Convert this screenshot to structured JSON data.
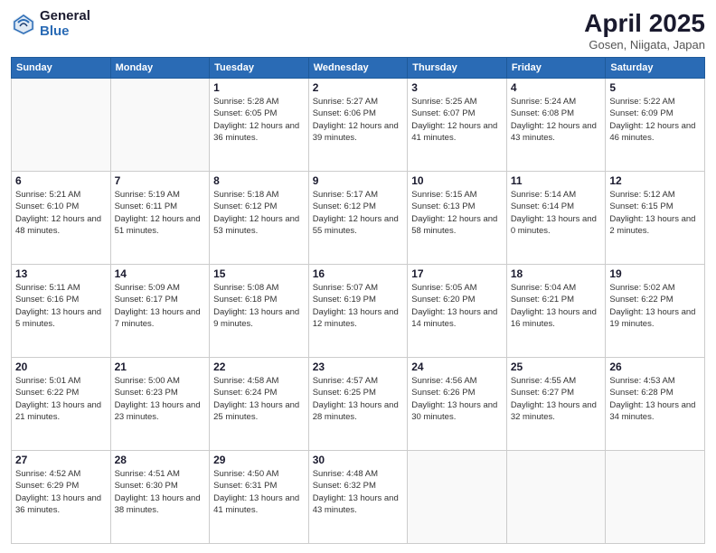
{
  "logo": {
    "general": "General",
    "blue": "Blue"
  },
  "title": "April 2025",
  "subtitle": "Gosen, Niigata, Japan",
  "days": [
    "Sunday",
    "Monday",
    "Tuesday",
    "Wednesday",
    "Thursday",
    "Friday",
    "Saturday"
  ],
  "weeks": [
    [
      {
        "day": "",
        "info": ""
      },
      {
        "day": "",
        "info": ""
      },
      {
        "day": "1",
        "info": "Sunrise: 5:28 AM\nSunset: 6:05 PM\nDaylight: 12 hours and 36 minutes."
      },
      {
        "day": "2",
        "info": "Sunrise: 5:27 AM\nSunset: 6:06 PM\nDaylight: 12 hours and 39 minutes."
      },
      {
        "day": "3",
        "info": "Sunrise: 5:25 AM\nSunset: 6:07 PM\nDaylight: 12 hours and 41 minutes."
      },
      {
        "day": "4",
        "info": "Sunrise: 5:24 AM\nSunset: 6:08 PM\nDaylight: 12 hours and 43 minutes."
      },
      {
        "day": "5",
        "info": "Sunrise: 5:22 AM\nSunset: 6:09 PM\nDaylight: 12 hours and 46 minutes."
      }
    ],
    [
      {
        "day": "6",
        "info": "Sunrise: 5:21 AM\nSunset: 6:10 PM\nDaylight: 12 hours and 48 minutes."
      },
      {
        "day": "7",
        "info": "Sunrise: 5:19 AM\nSunset: 6:11 PM\nDaylight: 12 hours and 51 minutes."
      },
      {
        "day": "8",
        "info": "Sunrise: 5:18 AM\nSunset: 6:12 PM\nDaylight: 12 hours and 53 minutes."
      },
      {
        "day": "9",
        "info": "Sunrise: 5:17 AM\nSunset: 6:12 PM\nDaylight: 12 hours and 55 minutes."
      },
      {
        "day": "10",
        "info": "Sunrise: 5:15 AM\nSunset: 6:13 PM\nDaylight: 12 hours and 58 minutes."
      },
      {
        "day": "11",
        "info": "Sunrise: 5:14 AM\nSunset: 6:14 PM\nDaylight: 13 hours and 0 minutes."
      },
      {
        "day": "12",
        "info": "Sunrise: 5:12 AM\nSunset: 6:15 PM\nDaylight: 13 hours and 2 minutes."
      }
    ],
    [
      {
        "day": "13",
        "info": "Sunrise: 5:11 AM\nSunset: 6:16 PM\nDaylight: 13 hours and 5 minutes."
      },
      {
        "day": "14",
        "info": "Sunrise: 5:09 AM\nSunset: 6:17 PM\nDaylight: 13 hours and 7 minutes."
      },
      {
        "day": "15",
        "info": "Sunrise: 5:08 AM\nSunset: 6:18 PM\nDaylight: 13 hours and 9 minutes."
      },
      {
        "day": "16",
        "info": "Sunrise: 5:07 AM\nSunset: 6:19 PM\nDaylight: 13 hours and 12 minutes."
      },
      {
        "day": "17",
        "info": "Sunrise: 5:05 AM\nSunset: 6:20 PM\nDaylight: 13 hours and 14 minutes."
      },
      {
        "day": "18",
        "info": "Sunrise: 5:04 AM\nSunset: 6:21 PM\nDaylight: 13 hours and 16 minutes."
      },
      {
        "day": "19",
        "info": "Sunrise: 5:02 AM\nSunset: 6:22 PM\nDaylight: 13 hours and 19 minutes."
      }
    ],
    [
      {
        "day": "20",
        "info": "Sunrise: 5:01 AM\nSunset: 6:22 PM\nDaylight: 13 hours and 21 minutes."
      },
      {
        "day": "21",
        "info": "Sunrise: 5:00 AM\nSunset: 6:23 PM\nDaylight: 13 hours and 23 minutes."
      },
      {
        "day": "22",
        "info": "Sunrise: 4:58 AM\nSunset: 6:24 PM\nDaylight: 13 hours and 25 minutes."
      },
      {
        "day": "23",
        "info": "Sunrise: 4:57 AM\nSunset: 6:25 PM\nDaylight: 13 hours and 28 minutes."
      },
      {
        "day": "24",
        "info": "Sunrise: 4:56 AM\nSunset: 6:26 PM\nDaylight: 13 hours and 30 minutes."
      },
      {
        "day": "25",
        "info": "Sunrise: 4:55 AM\nSunset: 6:27 PM\nDaylight: 13 hours and 32 minutes."
      },
      {
        "day": "26",
        "info": "Sunrise: 4:53 AM\nSunset: 6:28 PM\nDaylight: 13 hours and 34 minutes."
      }
    ],
    [
      {
        "day": "27",
        "info": "Sunrise: 4:52 AM\nSunset: 6:29 PM\nDaylight: 13 hours and 36 minutes."
      },
      {
        "day": "28",
        "info": "Sunrise: 4:51 AM\nSunset: 6:30 PM\nDaylight: 13 hours and 38 minutes."
      },
      {
        "day": "29",
        "info": "Sunrise: 4:50 AM\nSunset: 6:31 PM\nDaylight: 13 hours and 41 minutes."
      },
      {
        "day": "30",
        "info": "Sunrise: 4:48 AM\nSunset: 6:32 PM\nDaylight: 13 hours and 43 minutes."
      },
      {
        "day": "",
        "info": ""
      },
      {
        "day": "",
        "info": ""
      },
      {
        "day": "",
        "info": ""
      }
    ]
  ]
}
